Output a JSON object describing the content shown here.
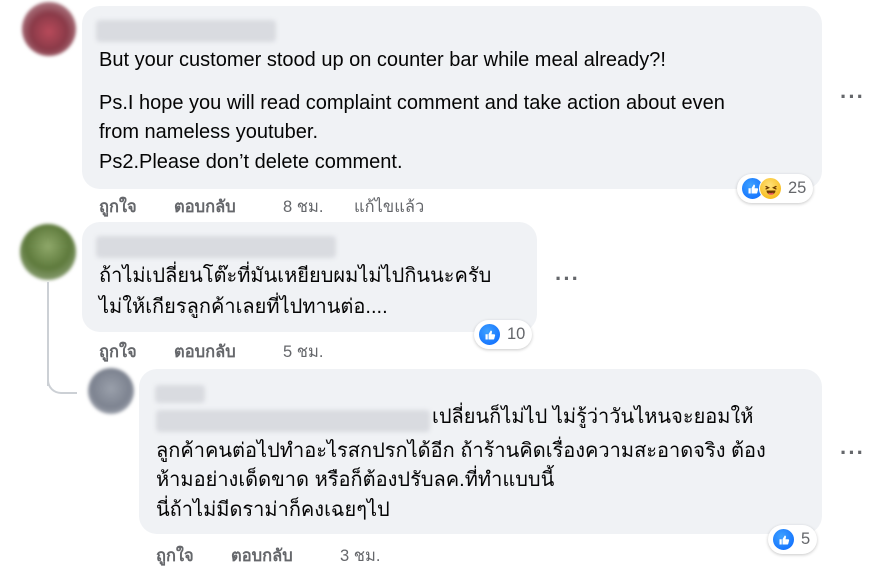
{
  "comments": [
    {
      "text_lines": [
        "But your customer stood up on counter bar while meal already?!",
        "Ps.I hope you will read complaint comment and take action about even",
        "from nameless youtuber.",
        "Ps2.Please don’t delete comment."
      ],
      "like_label": "ถูกใจ",
      "reply_label": "ตอบกลับ",
      "time": "8 ชม.",
      "edited": "แก้ไขแล้ว",
      "reaction_count": "25",
      "reaction_icons": [
        "like-icon",
        "haha-icon"
      ]
    },
    {
      "text_lines": [
        "ถ้าไม่เปลี่ยนโต๊ะที่มันเหยียบผมไม่ไปกินนะครับ",
        "ไม่ให้เกียรลูกค้าเลยที่ไปทานต่อ...."
      ],
      "like_label": "ถูกใจ",
      "reply_label": "ตอบกลับ",
      "time": "5 ชม.",
      "reaction_count": "10",
      "reaction_icons": [
        "like-icon"
      ]
    },
    {
      "text_lines": [
        "เปลี่ยนก็ไม่ไป ไม่รู้ว่าวันไหนจะยอมให้",
        "ลูกค้าคนต่อไปทำอะไรสกปรกได้อีก ถ้าร้านคิดเรื่องความสะอาดจริง ต้อง",
        "ห้ามอย่างเด็ดขาด หรือก็ต้องปรับลค.ที่ทำแบบนี้",
        "นี่ถ้าไม่มีดราม่าก็คงเฉยๆไป"
      ],
      "like_label": "ถูกใจ",
      "reply_label": "ตอบกลับ",
      "time": "3 ชม.",
      "reaction_count": "5",
      "reaction_icons": [
        "like-icon"
      ]
    }
  ],
  "more_glyph": "···",
  "colors": {
    "bubble": "#f0f2f5",
    "meta": "#65676b",
    "like_blue": "#0866ff",
    "haha_yellow": "#f5b000"
  }
}
